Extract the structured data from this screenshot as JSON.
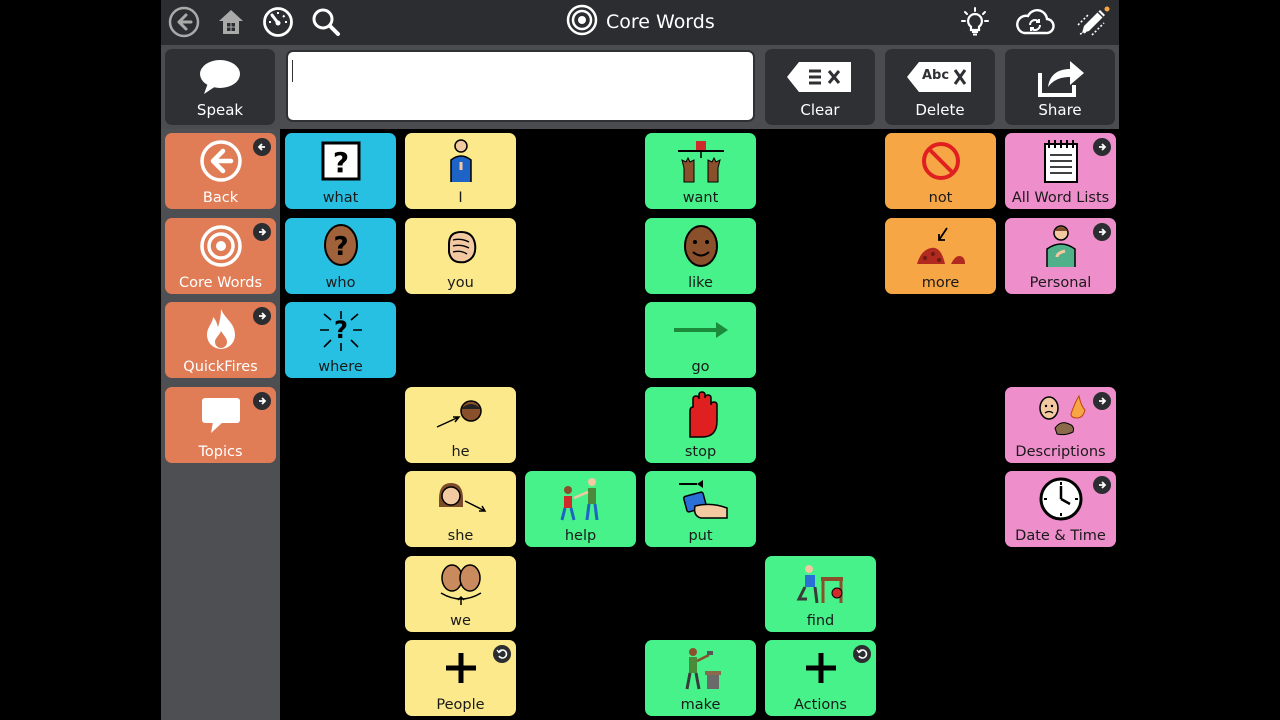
{
  "topbar": {
    "title": "Core Words",
    "icons": [
      "back-circle-icon",
      "home-icon",
      "dashboard-gauge-icon",
      "search-icon",
      "lightbulb-icon",
      "cloud-sync-icon",
      "edit-pencil-icon"
    ]
  },
  "controls": {
    "speak": "Speak",
    "clear": "Clear",
    "delete": "Delete",
    "share": "Share",
    "delete_icon_text": "Abc",
    "message_value": ""
  },
  "sidebar": {
    "back": "Back",
    "core_words": "Core Words",
    "quickfires": "QuickFires",
    "topics": "Topics"
  },
  "cells": {
    "what": "what",
    "who": "who",
    "where": "where",
    "i": "I",
    "you": "you",
    "he": "he",
    "she": "she",
    "we": "we",
    "people": "People",
    "help": "help",
    "want": "want",
    "like": "like",
    "go": "go",
    "stop": "stop",
    "put": "put",
    "make": "make",
    "find": "find",
    "actions": "Actions",
    "not": "not",
    "more": "more",
    "all_word_lists": "All Word Lists",
    "personal": "Personal",
    "descriptions": "Descriptions",
    "date_time": "Date & Time"
  },
  "colors": {
    "question": "#27c0e3",
    "pronoun": "#fbe98b",
    "verb": "#47f28a",
    "negation": "#f7a646",
    "folder": "#ee8ecb",
    "navigation": "#e07d56",
    "toolbar": "#2b2d30"
  }
}
